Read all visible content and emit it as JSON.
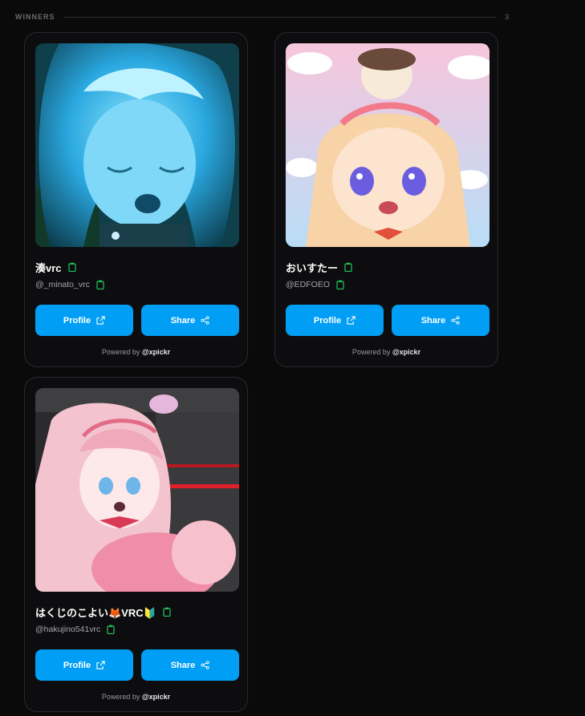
{
  "section": {
    "title": "WINNERS",
    "count": "3"
  },
  "cards": [
    {
      "name": "湊vrc",
      "handle": "@_minato_vrc",
      "profile_label": "Profile",
      "share_label": "Share",
      "powered_prefix": "Powered by ",
      "powered_brand": "@xpickr",
      "image": "avatar-blue-hair-anime-girl"
    },
    {
      "name": "おいすたー",
      "handle": "@EDFOEO",
      "profile_label": "Profile",
      "share_label": "Share",
      "powered_prefix": "Powered by ",
      "powered_brand": "@xpickr",
      "image": "avatar-chibi-blonde-girl-pink-bg"
    },
    {
      "name": "はくじのこよい🦊VRC🔰",
      "handle": "@hakujino541vrc",
      "profile_label": "Profile",
      "share_label": "Share",
      "powered_prefix": "Powered by ",
      "powered_brand": "@xpickr",
      "image": "avatar-pink-hair-maid-girl"
    }
  ],
  "colors": {
    "accent": "#009ff5",
    "clip_icon": "#22c55e",
    "card_border": "#2a2a2e"
  },
  "icons": {
    "copy": "clipboard-icon",
    "profile": "external-link-icon",
    "share": "share-icon"
  }
}
